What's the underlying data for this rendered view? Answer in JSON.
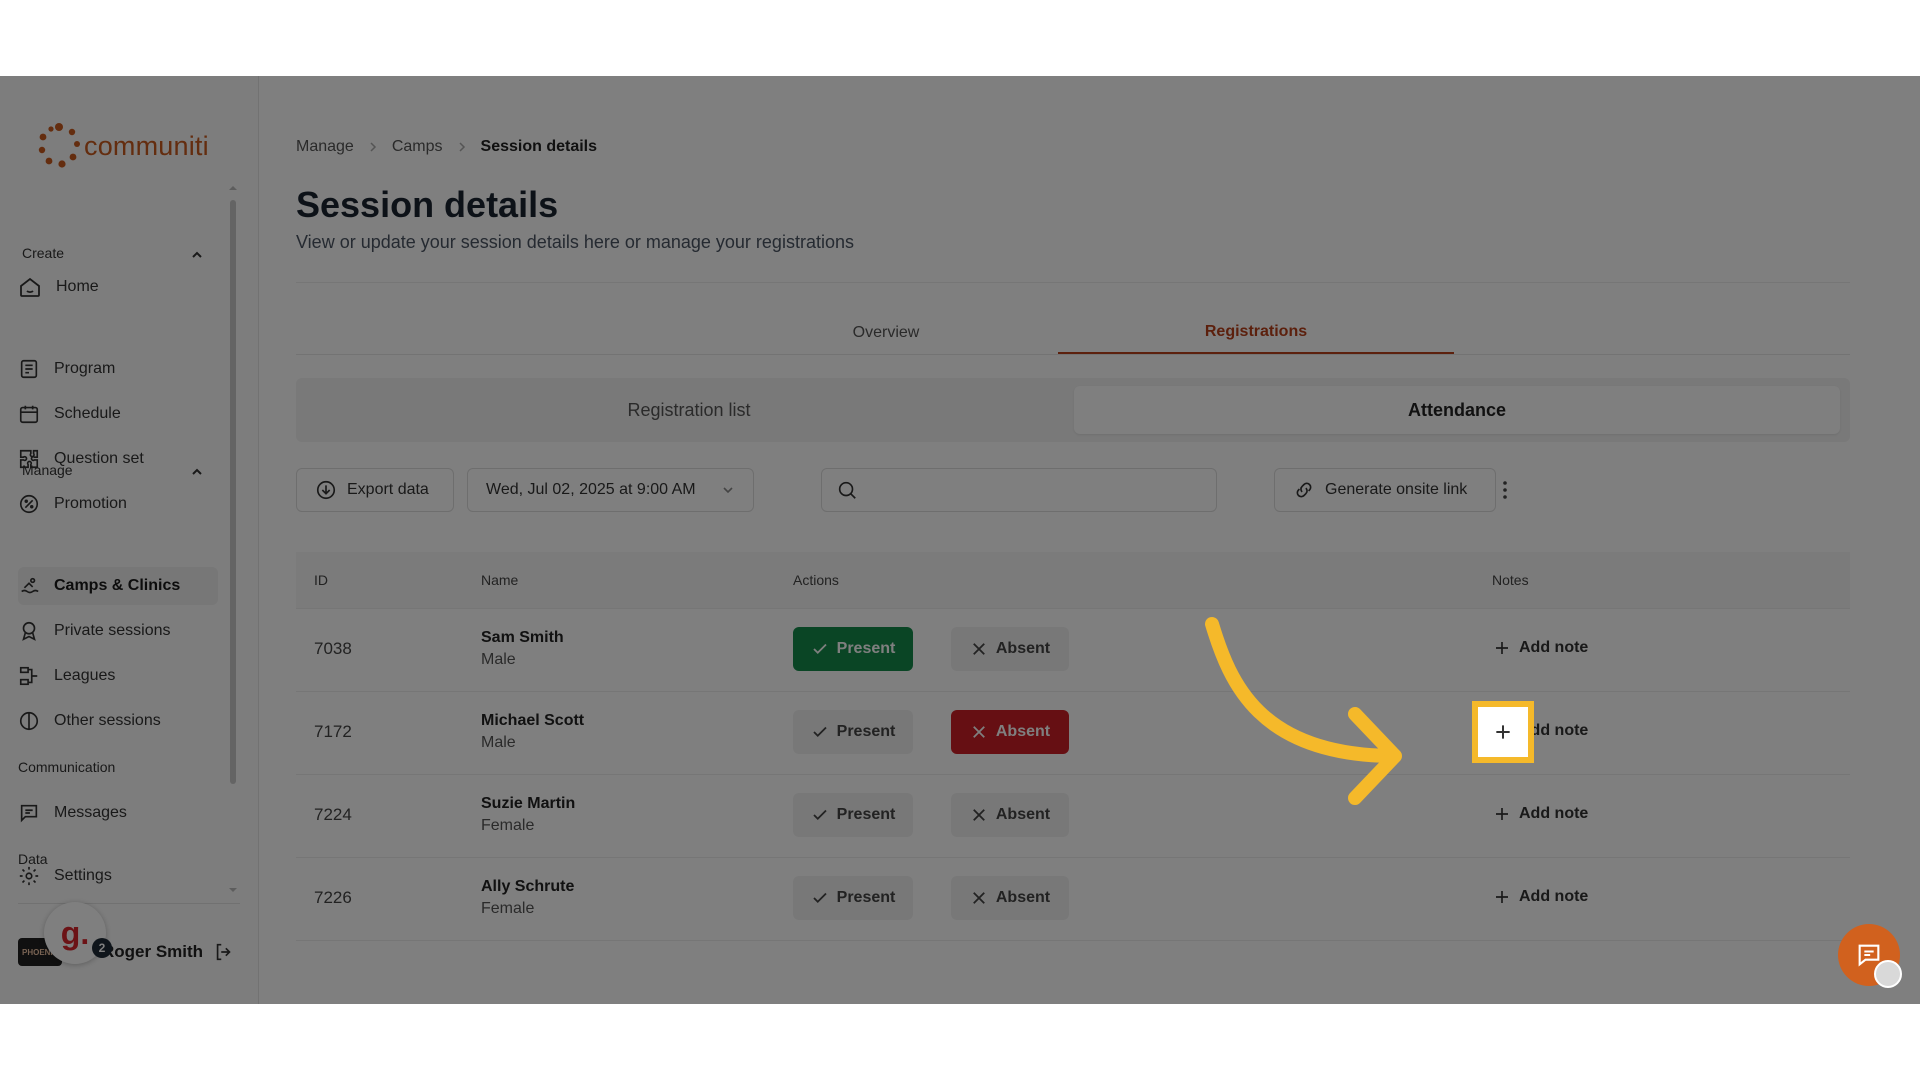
{
  "app": {
    "logo_text": "communiti"
  },
  "sidebar": {
    "home": "Home",
    "create_label": "Create",
    "create_items": [
      "Program",
      "Schedule",
      "Question set",
      "Promotion"
    ],
    "manage_label": "Manage",
    "manage_items": [
      "Camps & Clinics",
      "Private sessions",
      "Leagues",
      "Other sessions"
    ],
    "communication_label": "Communication",
    "messages": "Messages",
    "data_label": "Data",
    "settings": "Settings",
    "user_name": "Roger Smith",
    "org_logo_text": "PHOENIX",
    "badge_letter": "g.",
    "badge_count": "2"
  },
  "breadcrumb": [
    "Manage",
    "Camps",
    "Session details"
  ],
  "page": {
    "title": "Session details",
    "subtitle": "View or update your session details here or manage your registrations"
  },
  "tabs": [
    "Overview",
    "Registrations"
  ],
  "active_tab": "Registrations",
  "segments": [
    "Registration list",
    "Attendance"
  ],
  "active_segment": "Attendance",
  "toolbar": {
    "export_label": "Export data",
    "date_value": "Wed, Jul 02, 2025 at 9:00 AM",
    "search_placeholder": "",
    "generate_label": "Generate onsite link"
  },
  "table": {
    "headers": [
      "ID",
      "Name",
      "Actions",
      "Notes"
    ],
    "present_label": "Present",
    "absent_label": "Absent",
    "add_note_label": "Add note",
    "rows": [
      {
        "id": "7038",
        "name": "Sam Smith",
        "gender": "Male",
        "status": "present"
      },
      {
        "id": "7172",
        "name": "Michael Scott",
        "gender": "Male",
        "status": "absent"
      },
      {
        "id": "7224",
        "name": "Suzie Martin",
        "gender": "Female",
        "status": "none"
      },
      {
        "id": "7226",
        "name": "Ally Schrute",
        "gender": "Female",
        "status": "none"
      }
    ]
  },
  "colors": {
    "brand": "#c85a1e",
    "present": "#158a4a",
    "absent": "#cc1f26",
    "highlight": "#f5b92a"
  }
}
